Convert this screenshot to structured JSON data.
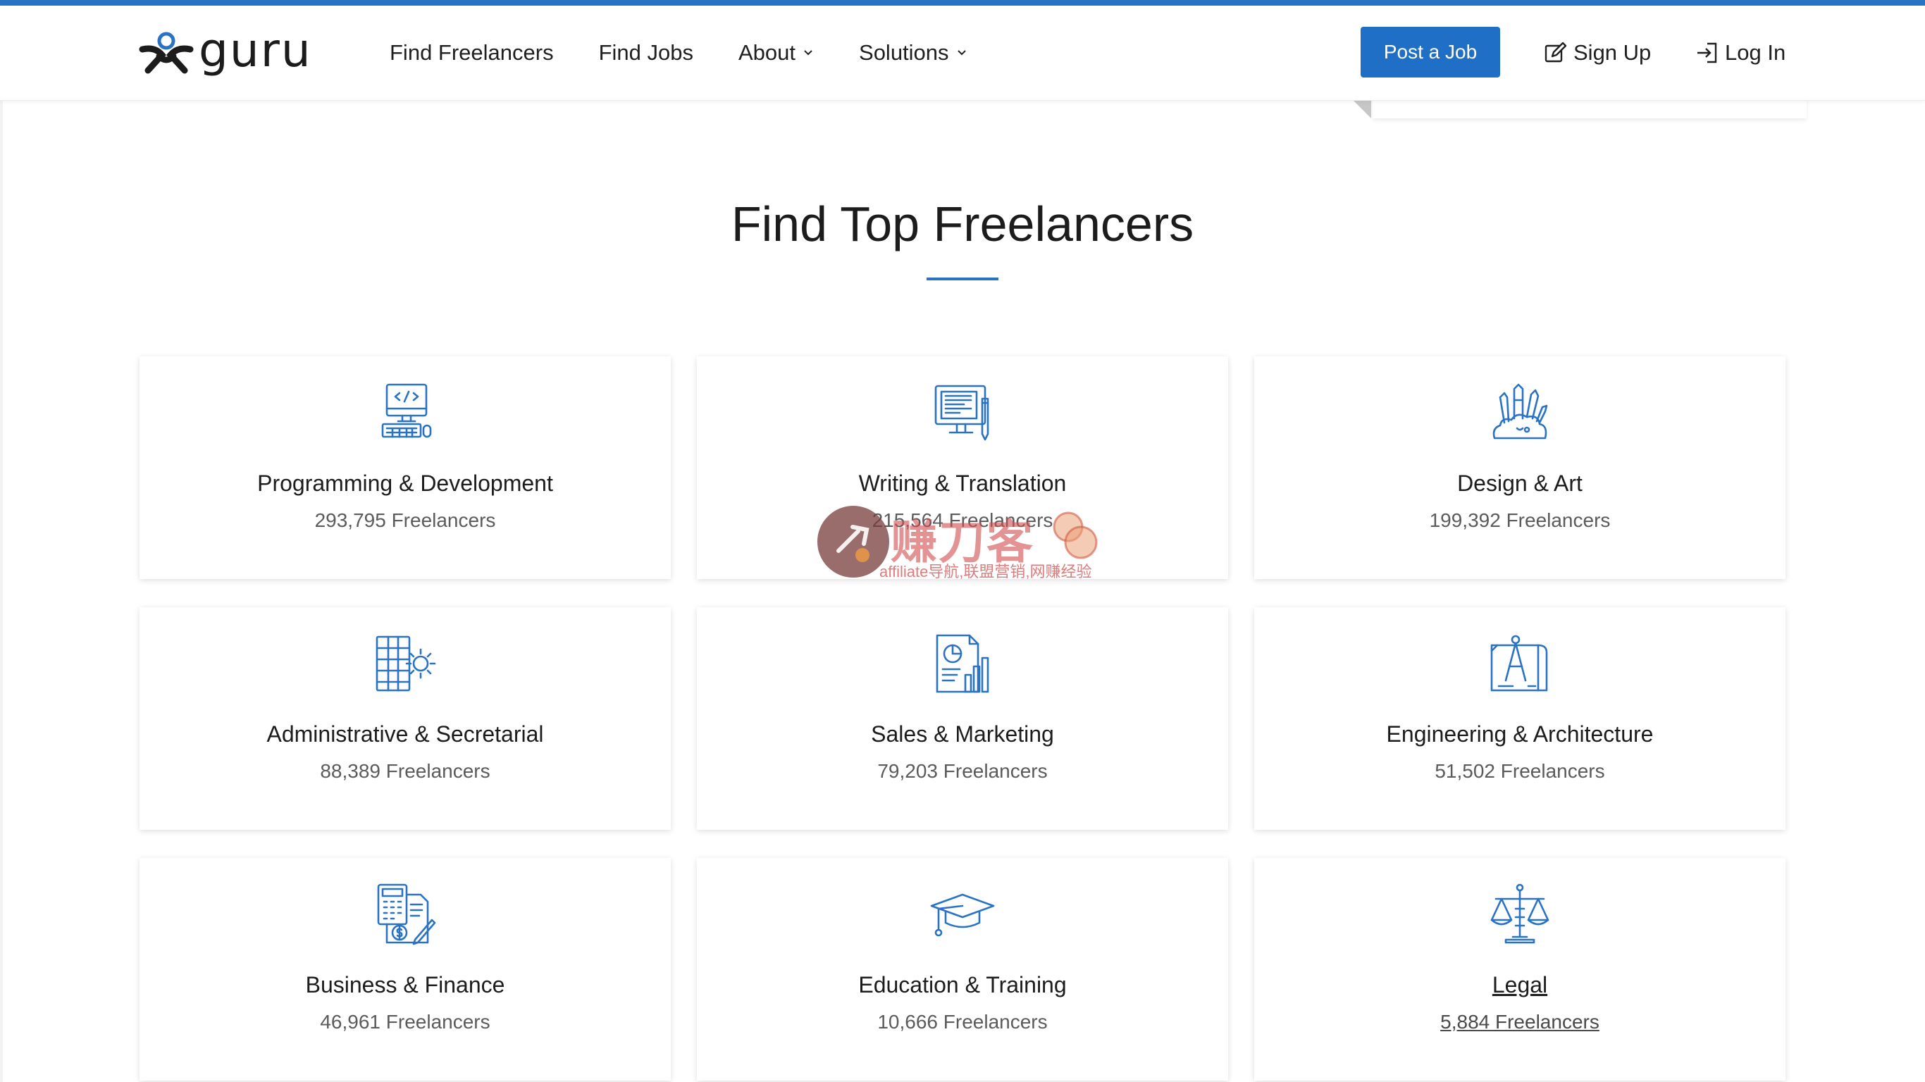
{
  "nav": {
    "logo_text": "guru",
    "links": [
      {
        "label": "Find Freelancers",
        "has_dropdown": false
      },
      {
        "label": "Find Jobs",
        "has_dropdown": false
      },
      {
        "label": "About",
        "has_dropdown": true
      },
      {
        "label": "Solutions",
        "has_dropdown": true
      }
    ],
    "post_job_label": "Post a Job",
    "signup_label": "Sign Up",
    "login_label": "Log In"
  },
  "section": {
    "title": "Find Top Freelancers"
  },
  "categories": [
    {
      "title": "Programming & Development",
      "count": "293,795 Freelancers",
      "icon": "code-monitor-icon"
    },
    {
      "title": "Writing & Translation",
      "count": "215,564 Freelancers",
      "icon": "writing-monitor-icon"
    },
    {
      "title": "Design & Art",
      "count": "199,392 Freelancers",
      "icon": "art-brushes-icon"
    },
    {
      "title": "Administrative & Secretarial",
      "count": "88,389 Freelancers",
      "icon": "admin-gear-icon"
    },
    {
      "title": "Sales & Marketing",
      "count": "79,203 Freelancers",
      "icon": "sales-chart-icon"
    },
    {
      "title": "Engineering & Architecture",
      "count": "51,502 Freelancers",
      "icon": "blueprint-compass-icon"
    },
    {
      "title": "Business & Finance",
      "count": "46,961 Freelancers",
      "icon": "calculator-finance-icon"
    },
    {
      "title": "Education & Training",
      "count": "10,666 Freelancers",
      "icon": "graduation-cap-icon"
    },
    {
      "title": "Legal",
      "count": "5,884 Freelancers",
      "icon": "scales-icon"
    }
  ],
  "watermark": {
    "cn_text": "赚刀客",
    "en_text": "affiliate导航,联盟营销,网赚经验"
  },
  "colors": {
    "accent": "#2a73c4",
    "button": "#1f6fc6",
    "icon": "#2a73c4"
  }
}
